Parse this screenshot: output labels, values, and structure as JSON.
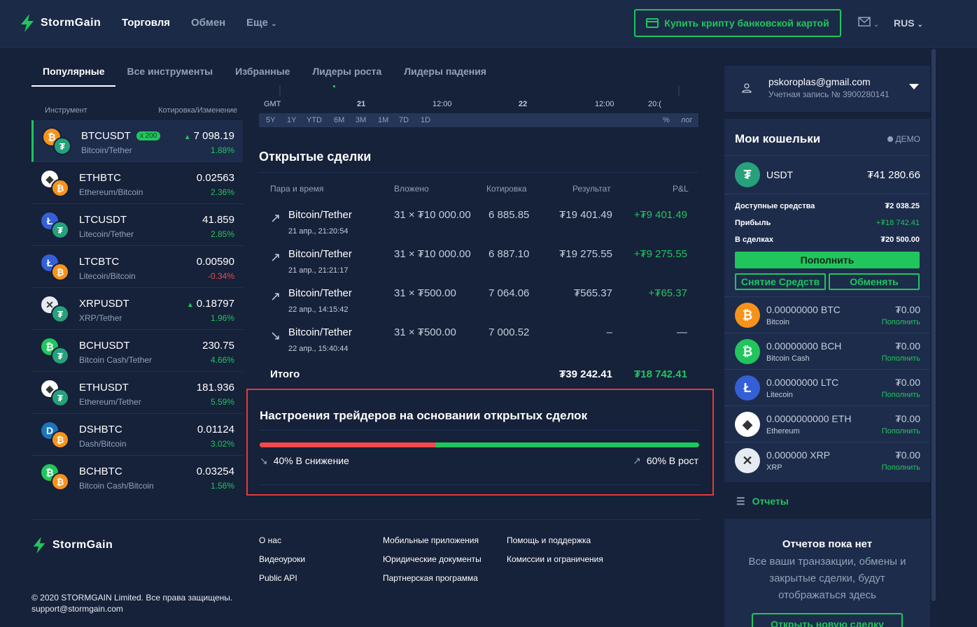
{
  "header": {
    "logo": "StormGain",
    "nav": [
      "Торговля",
      "Обмен",
      "Еще"
    ],
    "buy_button": "Купить крипту банковской картой",
    "lang": "RUS"
  },
  "tabs": [
    "Популярные",
    "Все инструменты",
    "Избранные",
    "Лидеры роста",
    "Лидеры падения"
  ],
  "instruments": {
    "col_instrument": "Инструмент",
    "col_quote": "Котировка/Изменение",
    "rows": [
      {
        "symbol": "BTCUSDT",
        "badge": "x 200",
        "name": "Bitcoin/Tether",
        "price": "7 098.19",
        "change": "1.88%"
      },
      {
        "symbol": "ETHBTC",
        "name": "Ethereum/Bitcoin",
        "price": "0.02563",
        "change": "2.36%"
      },
      {
        "symbol": "LTCUSDT",
        "name": "Litecoin/Tether",
        "price": "41.859",
        "change": "2.85%"
      },
      {
        "symbol": "LTCBTC",
        "name": "Litecoin/Bitcoin",
        "price": "0.00590",
        "change": "-0.34%"
      },
      {
        "symbol": "XRPUSDT",
        "name": "XRP/Tether",
        "price": "0.18797",
        "change": "1.96%"
      },
      {
        "symbol": "BCHUSDT",
        "name": "Bitcoin Cash/Tether",
        "price": "230.75",
        "change": "4.66%"
      },
      {
        "symbol": "ETHUSDT",
        "name": "Ethereum/Tether",
        "price": "181.936",
        "change": "5.59%"
      },
      {
        "symbol": "DSHBTC",
        "name": "Dash/Bitcoin",
        "price": "0.01124",
        "change": "3.02%"
      },
      {
        "symbol": "BCHBTC",
        "name": "Bitcoin Cash/Bitcoin",
        "price": "0.03254",
        "change": "1.56%"
      }
    ]
  },
  "chart": {
    "timezone": "GMT",
    "axis_labels": [
      "21",
      "12:00",
      "22",
      "12:00",
      "20:("
    ],
    "ranges": [
      "5Y",
      "1Y",
      "YTD",
      "6M",
      "3M",
      "1M",
      "7D",
      "1D"
    ],
    "percent": "%",
    "log": "лог"
  },
  "deals": {
    "title": "Открытые сделки",
    "headers": [
      "Пара и время",
      "Вложено",
      "Котировка",
      "Результат",
      "P&L"
    ],
    "rows": [
      {
        "pair": "Bitcoin/Tether",
        "time": "21 апр., 21:20:54",
        "invested": "31 × ₮10 000.00",
        "quote": "6 885.85",
        "result": "₮19 401.49",
        "pnl": "+₮9 401.49",
        "direction": "up"
      },
      {
        "pair": "Bitcoin/Tether",
        "time": "21 апр., 21:21:17",
        "invested": "31 × ₮10 000.00",
        "quote": "6 887.10",
        "result": "₮19 275.55",
        "pnl": "+₮9 275.55",
        "direction": "up"
      },
      {
        "pair": "Bitcoin/Tether",
        "time": "22 апр., 14:15:42",
        "invested": "31 × ₮500.00",
        "quote": "7 064.06",
        "result": "₮565.37",
        "pnl": "+₮65.37",
        "direction": "up"
      },
      {
        "pair": "Bitcoin/Tether",
        "time": "22 апр., 15:40:44",
        "invested": "31 × ₮500.00",
        "quote": "7 000.52",
        "result": "–",
        "pnl": "—",
        "direction": "down"
      }
    ],
    "total_label": "Итого",
    "total_result": "₮39 242.41",
    "total_pnl": "₮18 742.41"
  },
  "sentiment": {
    "title": "Настроения трейдеров на основании открытых сделок",
    "down_fraction": 0.4,
    "down_label": "40% В снижение",
    "up_label": "60% В рост"
  },
  "footer": {
    "logo": "StormGain",
    "links_col1": [
      "О нас",
      "Видеоуроки",
      "Public API"
    ],
    "links_col2": [
      "Мобильные приложения",
      "Юридические документы",
      "Партнерская программа"
    ],
    "links_col3": [
      "Помощь и поддержка",
      "Комиссии и ограничения"
    ],
    "copyright": "© 2020 STORMGAIN Limited. Все права защищены.",
    "email": "support@stormgain.com"
  },
  "account": {
    "email": "pskoroplas@gmail.com",
    "number": "Учетная запись № 3900280141"
  },
  "wallets": {
    "title": "Мои кошельки",
    "mode": "ДЕМО",
    "main_currency": "USDT",
    "main_balance": "₮41 280.66",
    "available_label": "Доступные средства",
    "available": "₮2 038.25",
    "profit_label": "Прибыль",
    "profit": "+₮18 742.41",
    "in_deals_label": "В сделках",
    "in_deals": "₮20 500.00",
    "deposit_button": "Пополнить",
    "withdraw_button": "Снятие Средств",
    "exchange_button": "Обменять",
    "coins": [
      {
        "amount": "0.00000000 BTC",
        "name": "Bitcoin",
        "value": "₮0.00",
        "action": "Пополнить",
        "color": "#f7931a",
        "glyph": "₿"
      },
      {
        "amount": "0.00000000 BCH",
        "name": "Bitcoin Cash",
        "value": "₮0.00",
        "action": "Пополнить",
        "color": "#21c55d",
        "glyph": "₿"
      },
      {
        "amount": "0.00000000 LTC",
        "name": "Litecoin",
        "value": "₮0.00",
        "action": "Пополнить",
        "color": "#345fd8",
        "glyph": "Ł"
      },
      {
        "amount": "0.0000000000 ETH",
        "name": "Ethereum",
        "value": "₮0.00",
        "action": "Пополнить",
        "color": "#ffffff",
        "glyph": "◆"
      },
      {
        "amount": "0.000000 XRP",
        "name": "XRP",
        "value": "₮0.00",
        "action": "Пополнить",
        "color": "#e6ebf3",
        "glyph": "✕"
      }
    ]
  },
  "reports": {
    "link": "Отчеты",
    "empty_title": "Отчетов пока нет",
    "empty_text": "Все ваши транзакции, обмены и закрытые сделки, будут отображаться здесь",
    "new_deal_button": "Открыть новую сделку"
  }
}
